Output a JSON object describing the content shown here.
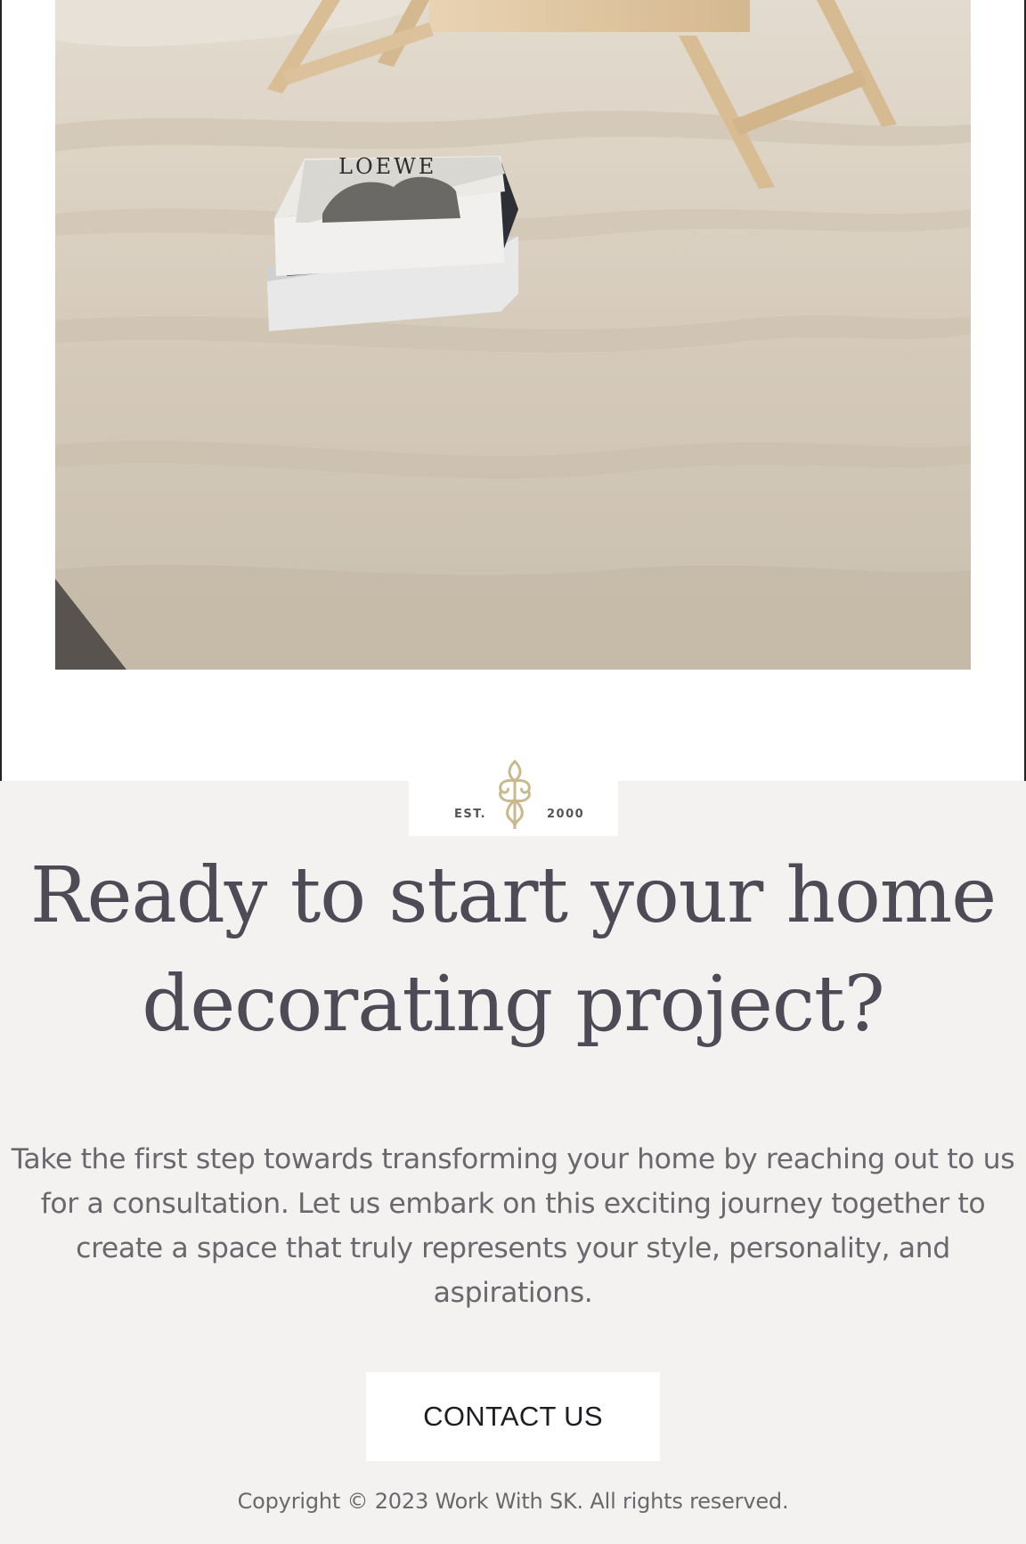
{
  "hero": {
    "image_description_icon": "bedroom-photo",
    "book_title": "LOEWE"
  },
  "logo": {
    "est_label": "EST.",
    "year_label": "2000",
    "ornament_color": "#c9b98f"
  },
  "cta": {
    "headline": "Ready to start your home decorating project?",
    "body": "Take the first step towards transforming your home by reaching out to us for a consultation. Let us embark on this exciting journey together to create a space that truly represents your style, personality, and aspirations.",
    "button_label": "CONTACT US",
    "background_color": "#f3f2f1",
    "headline_color": "#4d4b55"
  },
  "footer": {
    "copyright": "Copyright © 2023 Work With SK. All rights reserved."
  }
}
